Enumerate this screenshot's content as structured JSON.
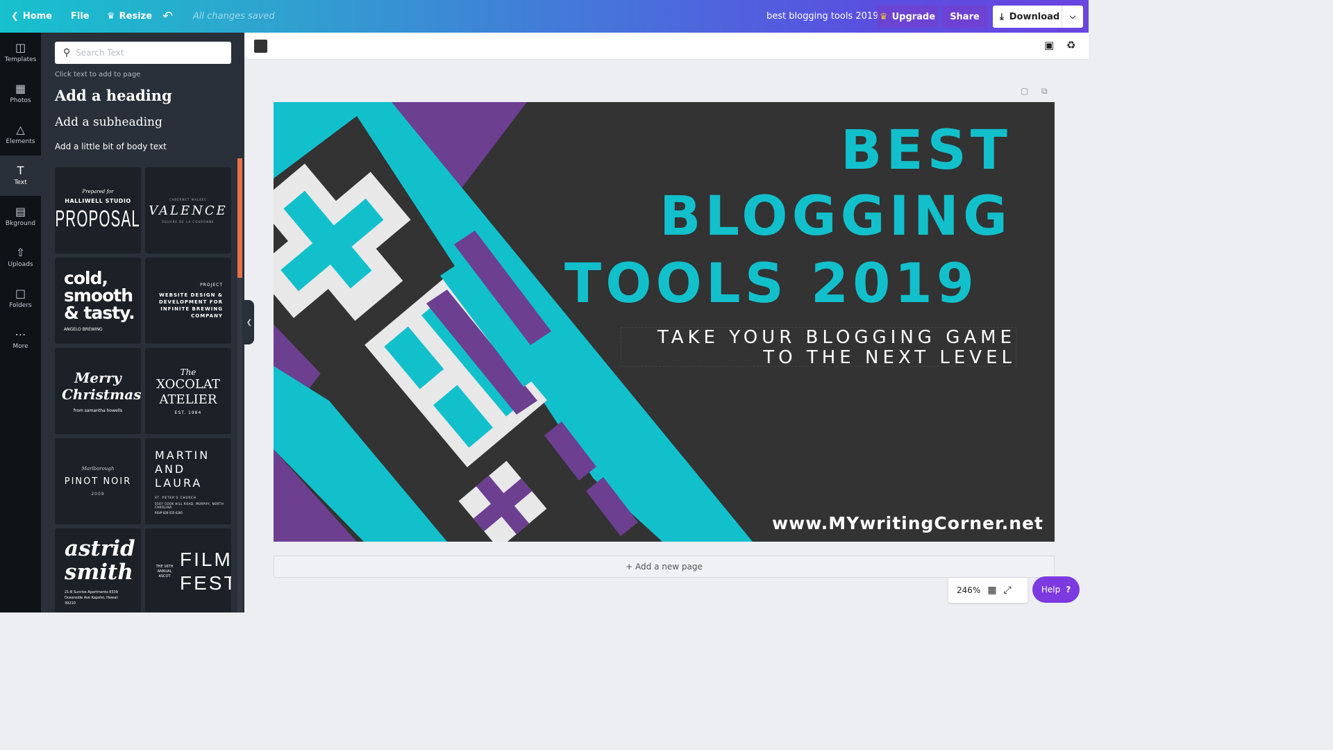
{
  "topbar": {
    "home": "Home",
    "file": "File",
    "resize": "Resize",
    "saved": "All changes saved",
    "title": "best blogging tools 2019",
    "upgrade": "Upgrade",
    "share": "Share",
    "download": "Download"
  },
  "rail": [
    {
      "label": "Templates",
      "icon": "templates-icon"
    },
    {
      "label": "Photos",
      "icon": "photos-icon"
    },
    {
      "label": "Elements",
      "icon": "elements-icon"
    },
    {
      "label": "Text",
      "icon": "text-icon"
    },
    {
      "label": "Bkground",
      "icon": "background-icon"
    },
    {
      "label": "Uploads",
      "icon": "uploads-icon"
    },
    {
      "label": "Folders",
      "icon": "folders-icon"
    },
    {
      "label": "More",
      "icon": "more-icon"
    }
  ],
  "panel": {
    "search_placeholder": "Search Text",
    "hint": "Click text to add to page",
    "add_heading": "Add a heading",
    "add_subheading": "Add a subheading",
    "add_body": "Add a little bit of body text"
  },
  "templates": {
    "t1": {
      "small": "Prepared for",
      "mid": "HALLIWELL STUDIO",
      "big": "PROPOSAL"
    },
    "t2": {
      "small": "CABERNET MALBEC",
      "big": "VALENCE",
      "foot": "SQUARE DE LA COURONNE"
    },
    "t3": {
      "big": "cold, smooth & tasty.",
      "foot": "ANGELO BREWING"
    },
    "t4": {
      "small": "PROJECT",
      "big": "WEBSITE DESIGN & DEVELOPMENT FOR INFINITE BREWING COMPANY"
    },
    "t5": {
      "big": "Merry Christmas!",
      "foot": "from samantha howells"
    },
    "t6": {
      "small": "The",
      "big": "XOCOLAT ATELIER",
      "foot": "EST. 1984"
    },
    "t7": {
      "small": "Marlborough",
      "big": "PINOT NOIR",
      "foot": "2009"
    },
    "t8": {
      "big": "MARTIN AND LAURA",
      "small": "ST. PETER'S CHURCH",
      "foot": "5567 COOK HILL ROAD, MURPHY, NORTH CAROLINA",
      "rsvp": "RSVP 828-555-0285"
    },
    "t9": {
      "big": "astrid smith",
      "foot": "21-B Sunrise Apartments 8339 Oceanside Ave Kapolei, Hawaii 39210"
    },
    "t10": {
      "small": "THE 16TH ANNUAL ASCOT",
      "big": "FILM FEST"
    }
  },
  "canvas": {
    "line1": "BEST",
    "line2": "BLOGGING",
    "line3": "TOOLS 2019",
    "sub1": "TAKE YOUR BLOGGING GAME",
    "sub2": "TO THE NEXT LEVEL",
    "url": "www.MYwritingCorner.net"
  },
  "colors": {
    "accent": "#12c0cc",
    "purple": "#6c3f91",
    "bg": "#333333"
  },
  "add_page": "+ Add a new page",
  "zoom": "246%",
  "help": "Help"
}
